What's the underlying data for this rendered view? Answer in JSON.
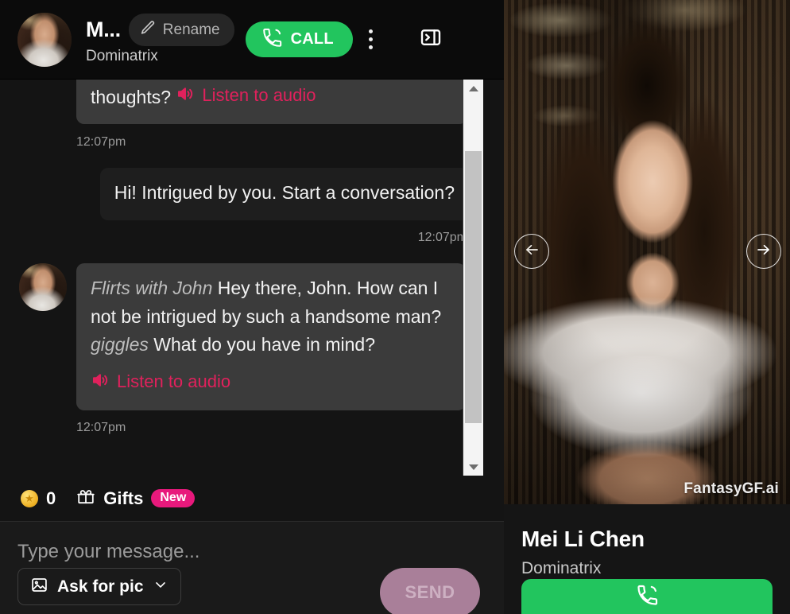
{
  "header": {
    "name_truncated": "M...",
    "role": "Dominatrix",
    "rename_label": "Rename",
    "call_label": "CALL",
    "avatar_alt": "Mei Li Chen avatar",
    "icons": {
      "pencil": "pencil-icon",
      "phone": "phone-call-icon",
      "kebab": "more-options-icon",
      "collapse": "collapse-panel-right-icon"
    }
  },
  "messages": [
    {
      "id": "m1",
      "sender": "ai",
      "clipped": true,
      "text": "makes life exciting. Care to share your thoughts?",
      "audio_label": "Listen to audio",
      "time": "12:07pm"
    },
    {
      "id": "m2",
      "sender": "user",
      "text": "Hi! Intrigued by you. Start a conversation?",
      "time": "12:07pm"
    },
    {
      "id": "m3",
      "sender": "ai",
      "action_1": "Flirts with John",
      "text_1": "Hey there, John. How can I not be intrigued by such a handsome man?",
      "action_2": "giggles",
      "text_2": "What do you have in mind?",
      "audio_label": "Listen to audio",
      "time": "12:07pm"
    }
  ],
  "gift_bar": {
    "coin_value": "0",
    "gifts_label": "Gifts",
    "new_badge": "New",
    "coin_icon": "coin-icon",
    "gift_icon": "gift-icon"
  },
  "composer": {
    "placeholder": "Type your message...",
    "value": "",
    "ask_for_pic_label": "Ask for pic",
    "send_label": "SEND",
    "image_icon": "image-icon",
    "chevron_icon": "chevron-down-icon"
  },
  "profile": {
    "name": "Mei Li Chen",
    "role": "Dominatrix",
    "watermark": "FantasyGF.ai",
    "prev_icon": "arrow-left-icon",
    "next_icon": "arrow-right-icon",
    "call_icon": "phone-call-icon"
  },
  "scrollbar": {
    "up_icon": "scroll-up-arrow-icon",
    "down_icon": "scroll-down-arrow-icon"
  },
  "colors": {
    "accent_green": "#22c55e",
    "accent_pink": "#e0215c",
    "badge_pink": "#e8197c",
    "send_disabled": "#a97f99",
    "bubble_ai": "#3b3b3b",
    "bubble_user": "#1e1e1e",
    "page_bg": "#141414"
  }
}
